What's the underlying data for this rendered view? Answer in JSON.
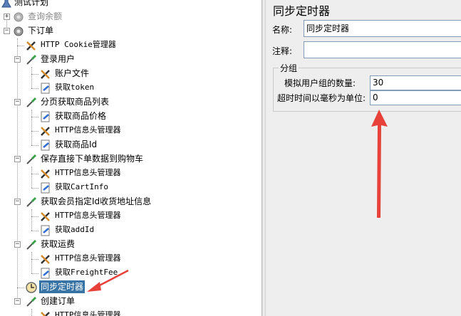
{
  "tree": {
    "items": [
      {
        "label": "测试计划",
        "icon": "flask-icon"
      },
      {
        "label": "查询余额",
        "icon": "gear-icon"
      },
      {
        "label": "下订单",
        "icon": "gear-icon"
      },
      {
        "label": "HTTP Cookie管理器",
        "icon": "wrench-icon"
      },
      {
        "label": "登录用户",
        "icon": "pipette-icon"
      },
      {
        "label": "账户文件",
        "icon": "wrench-icon"
      },
      {
        "label": "获取token",
        "icon": "sampler-icon"
      },
      {
        "label": "分页获取商品列表",
        "icon": "pipette-icon"
      },
      {
        "label": "获取商品价格",
        "icon": "sampler-icon"
      },
      {
        "label": "HTTP信息头管理器",
        "icon": "wrench-icon"
      },
      {
        "label": "获取商品Id",
        "icon": "sampler-icon"
      },
      {
        "label": "保存直接下单数据到购物车",
        "icon": "pipette-icon"
      },
      {
        "label": "HTTP信息头管理器",
        "icon": "wrench-icon"
      },
      {
        "label": "获取CartInfo",
        "icon": "sampler-icon"
      },
      {
        "label": "获取会员指定Id收货地址信息",
        "icon": "pipette-icon"
      },
      {
        "label": "HTTP信息头管理器",
        "icon": "wrench-icon"
      },
      {
        "label": "获取addId",
        "icon": "sampler-icon"
      },
      {
        "label": "获取运费",
        "icon": "pipette-icon"
      },
      {
        "label": "HTTP信息头管理器",
        "icon": "wrench-icon"
      },
      {
        "label": "获取FreightFee",
        "icon": "sampler-icon"
      },
      {
        "label": "同步定时器",
        "icon": "timer-icon"
      },
      {
        "label": "创建订单",
        "icon": "pipette-icon"
      },
      {
        "label": "HTTP信息头管理器",
        "icon": "wrench-icon"
      }
    ],
    "expand_minus": "−",
    "expand_plus": "+"
  },
  "panel": {
    "title": "同步定时器",
    "name_label": "名称:",
    "name_value": "同步定时器",
    "comment_label": "注释:",
    "comment_value": "",
    "group_title": "分组",
    "users_label": "模拟用户组的数量:",
    "users_value": "30",
    "timeout_label": "超时时间以毫秒为单位:",
    "timeout_value": "0"
  },
  "colors": {
    "selection": "#3873a5",
    "annotation_arrow": "#e8413a",
    "panel_bg": "#eeeeee"
  }
}
